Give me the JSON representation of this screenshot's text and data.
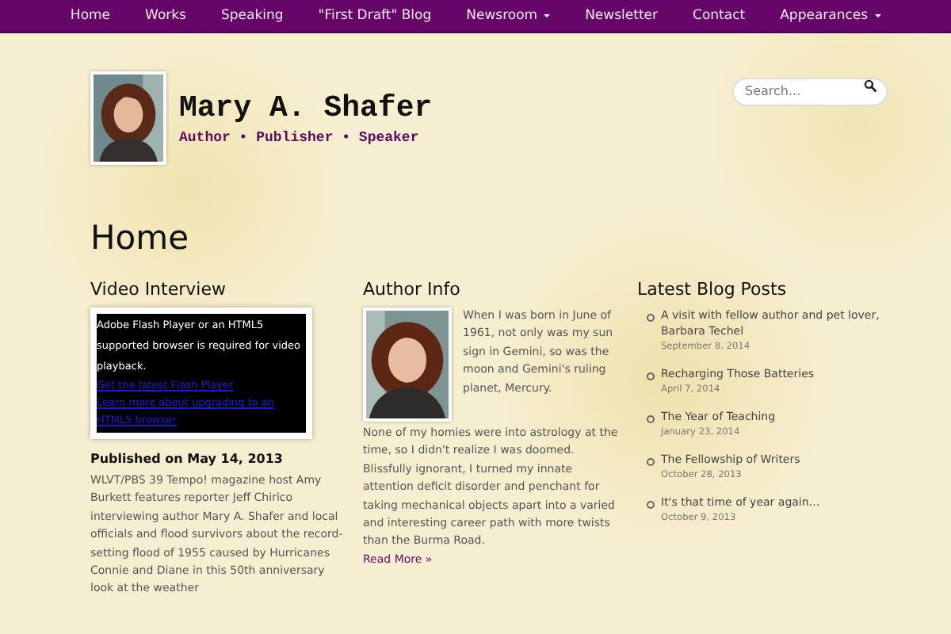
{
  "nav": [
    {
      "label": "Home",
      "has_dropdown": false
    },
    {
      "label": "Works",
      "has_dropdown": false
    },
    {
      "label": "Speaking",
      "has_dropdown": false
    },
    {
      "label": "\"First Draft\" Blog",
      "has_dropdown": false
    },
    {
      "label": "Newsroom",
      "has_dropdown": true
    },
    {
      "label": "Newsletter",
      "has_dropdown": false
    },
    {
      "label": "Contact",
      "has_dropdown": false
    },
    {
      "label": "Appearances",
      "has_dropdown": true
    }
  ],
  "header": {
    "name": "Mary A. Shafer",
    "tagline": "Author • Publisher • Speaker"
  },
  "search": {
    "placeholder": "Search..."
  },
  "page_title": "Home",
  "video": {
    "title": "Video Interview",
    "player_message": "Adobe Flash Player or an HTML5 supported browser is required for video playback.",
    "links": [
      "Get the latest Flash Player",
      "Learn more about upgrading to an HTML5 browser"
    ],
    "published": "Published on May 14, 2013",
    "description": "WLVT/PBS 39 Tempo! magazine host Amy Burkett features reporter Jeff Chirico interviewing author Mary A. Shafer and local officials and flood survivors about the record-setting flood of 1955 caused by Hurricanes Connie and Diane in this 50th anniversary look at the weather"
  },
  "author": {
    "title": "Author Info",
    "bio_beside_photo": "When I was born in June of 1961, not only was my sun sign in Gemini, so was the moon and Gemini's ruling planet, Mercury.",
    "bio_below_photo": "None of my homies were into astrology at the time, so I didn't realize I was doomed. Blissfully ignorant, I turned my innate attention deficit disorder and penchant for taking mechanical objects apart into a varied and interesting career path with more twists than the Burma Road.",
    "read_more": "Read More »"
  },
  "blog": {
    "title": "Latest Blog Posts",
    "posts": [
      {
        "title": "A visit with fellow author and pet lover, Barbara Techel",
        "date": "September 8, 2014"
      },
      {
        "title": "Recharging Those Batteries",
        "date": "April 7, 2014"
      },
      {
        "title": "The Year of Teaching",
        "date": "January 23, 2014"
      },
      {
        "title": "The Fellowship of Writers",
        "date": "October 28, 2013"
      },
      {
        "title": "It's that time of year again…",
        "date": "October 9, 2013"
      }
    ]
  }
}
